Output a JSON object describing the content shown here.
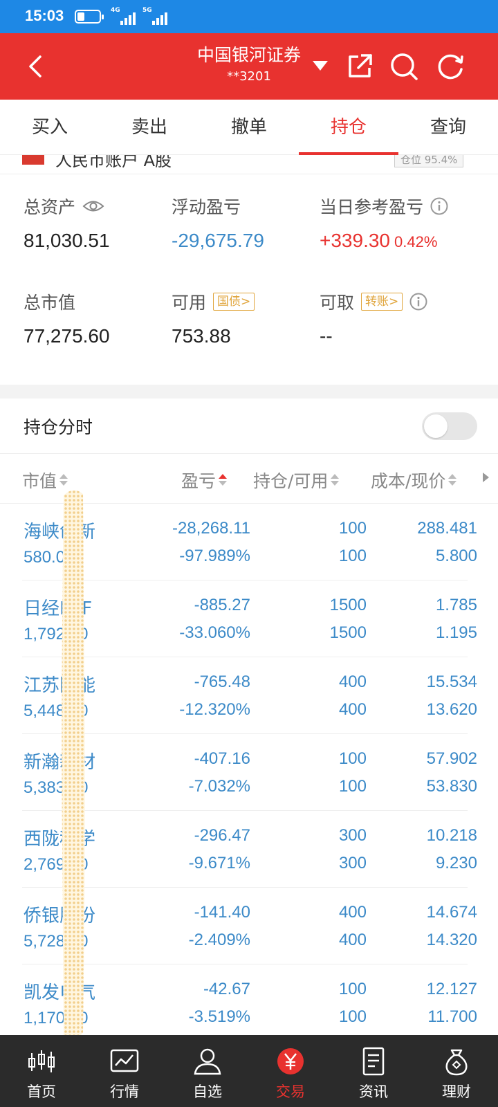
{
  "status_bar": {
    "time": "15:03",
    "net1": "4G",
    "net2": "5G"
  },
  "header": {
    "title": "中国银河证券",
    "account": "**3201"
  },
  "tabs": [
    {
      "label": "买入",
      "active": false
    },
    {
      "label": "卖出",
      "active": false
    },
    {
      "label": "撤单",
      "active": false
    },
    {
      "label": "持仓",
      "active": true
    },
    {
      "label": "查询",
      "active": false
    }
  ],
  "account_row": {
    "text": "人民币账户 A股",
    "position": "仓位 95.4%"
  },
  "summary": {
    "total_assets": {
      "label": "总资产",
      "value": "81,030.51"
    },
    "floating_pl": {
      "label": "浮动盈亏",
      "value": "-29,675.79"
    },
    "daily_pl": {
      "label": "当日参考盈亏",
      "value": "+339.30",
      "pct": "0.42%"
    },
    "market_value": {
      "label": "总市值",
      "value": "77,275.60"
    },
    "available": {
      "label": "可用",
      "tag": "国债>",
      "value": "753.88"
    },
    "withdrawable": {
      "label": "可取",
      "tag": "转账>",
      "value": "--"
    }
  },
  "position_timeshare": {
    "label": "持仓分时",
    "enabled": false
  },
  "table": {
    "headers": {
      "market_value": "市值",
      "pl": "盈亏",
      "holding": "持仓/可用",
      "cost": "成本/现价"
    },
    "rows": [
      {
        "name": "海峡创新",
        "mv": "580.00",
        "pl": "-28,268.11",
        "pl_rate": "-97.989%",
        "hold": "100",
        "avail": "100",
        "cost": "288.481",
        "price": "5.800"
      },
      {
        "name": "日经ETF",
        "mv": "1,792.50",
        "pl": "-885.27",
        "pl_rate": "-33.060%",
        "hold": "1500",
        "avail": "1500",
        "cost": "1.785",
        "price": "1.195"
      },
      {
        "name": "江苏国能",
        "mv": "5,448.00",
        "pl": "-765.48",
        "pl_rate": "-12.320%",
        "hold": "400",
        "avail": "400",
        "cost": "15.534",
        "price": "13.620"
      },
      {
        "name": "新瀚新材",
        "mv": "5,383.00",
        "pl": "-407.16",
        "pl_rate": "-7.032%",
        "hold": "100",
        "avail": "100",
        "cost": "57.902",
        "price": "53.830"
      },
      {
        "name": "西陇科学",
        "mv": "2,769.00",
        "pl": "-296.47",
        "pl_rate": "-9.671%",
        "hold": "300",
        "avail": "300",
        "cost": "10.218",
        "price": "9.230"
      },
      {
        "name": "侨银股份",
        "mv": "5,728.00",
        "pl": "-141.40",
        "pl_rate": "-2.409%",
        "hold": "400",
        "avail": "400",
        "cost": "14.674",
        "price": "14.320"
      },
      {
        "name": "凯发电气",
        "mv": "1,170.00",
        "pl": "-42.67",
        "pl_rate": "-3.519%",
        "hold": "100",
        "avail": "100",
        "cost": "12.127",
        "price": "11.700"
      }
    ]
  },
  "bottom_nav": [
    {
      "label": "首页",
      "icon": "candlestick-icon",
      "active": false
    },
    {
      "label": "行情",
      "icon": "chart-icon",
      "active": false
    },
    {
      "label": "自选",
      "icon": "person-icon",
      "active": false
    },
    {
      "label": "交易",
      "icon": "yuan-icon",
      "active": true
    },
    {
      "label": "资讯",
      "icon": "document-icon",
      "active": false
    },
    {
      "label": "理财",
      "icon": "money-bag-icon",
      "active": false
    }
  ],
  "colors": {
    "brand_red": "#e8322f",
    "status_blue": "#1e88e5",
    "value_blue": "#3c8ac8",
    "tag_orange": "#e0a43a"
  }
}
